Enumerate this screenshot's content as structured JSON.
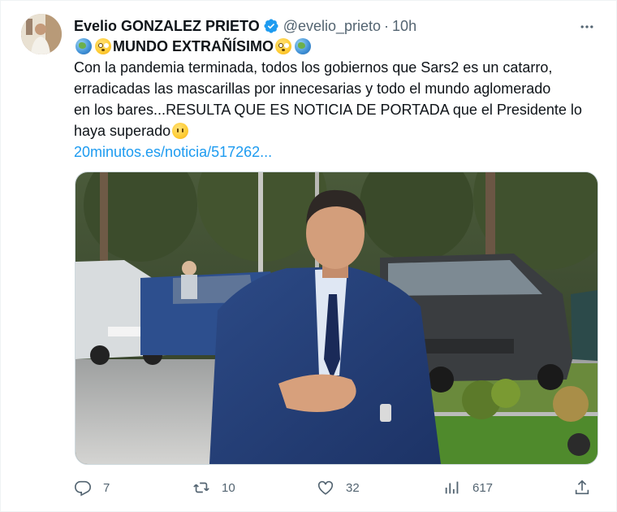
{
  "tweet": {
    "author_name": "Evelio GONZALEZ PRIETO",
    "handle": "@evelio_prieto",
    "separator": "·",
    "time": "10h",
    "more_label": "•••",
    "headline": "MUNDO EXTRAÑÍSIMO",
    "body_line1": "Con la pandemia terminada, todos los gobiernos que Sars2 es un catarro,",
    "body_line2": "erradicadas las mascarillas por innecesarias y todo el mundo aglomerado",
    "body_line3": "en los bares...RESULTA QUE ES NOTICIA DE PORTADA que el Presidente lo",
    "body_line4": "haya superado",
    "link_text": "20minutos.es/noticia/517262...",
    "accent_color": "#1d9bf0"
  },
  "actions": {
    "replies": "7",
    "retweets": "10",
    "likes": "32",
    "views": "617"
  },
  "icons": [
    "verified-badge-icon",
    "globe-emoji-icon",
    "flushed-face-emoji-icon",
    "no-mouth-face-emoji-icon",
    "reply-icon",
    "retweet-icon",
    "like-icon",
    "views-icon",
    "share-icon",
    "more-icon"
  ]
}
